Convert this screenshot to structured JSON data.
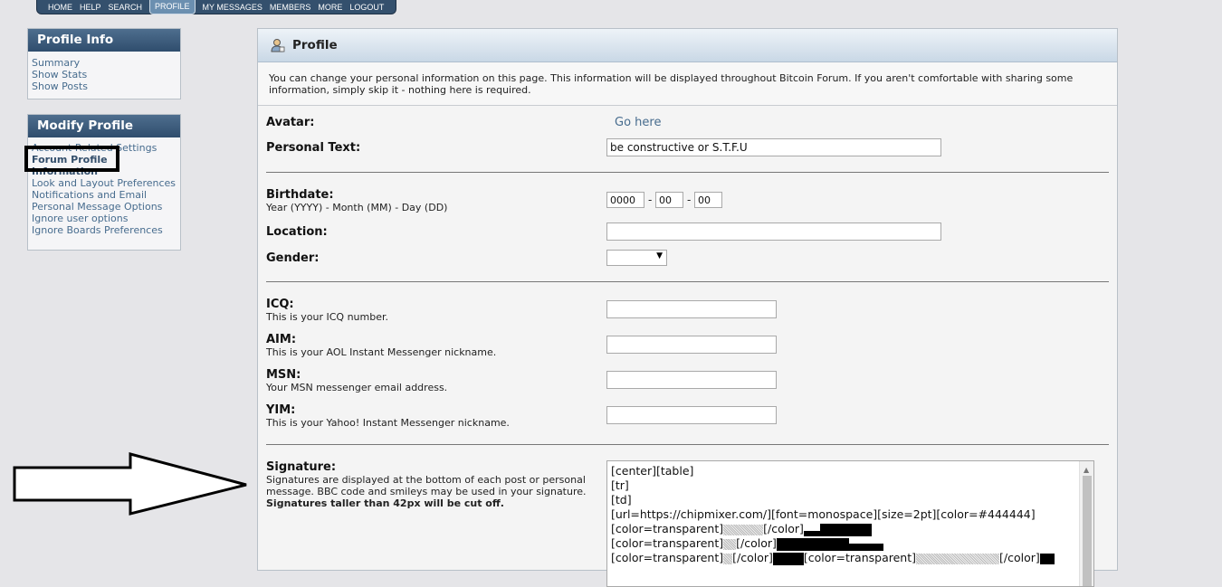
{
  "nav": {
    "items": [
      "HOME",
      "HELP",
      "SEARCH",
      "PROFILE",
      "MY MESSAGES",
      "MEMBERS",
      "MORE",
      "LOGOUT"
    ]
  },
  "sidebar": {
    "profile_info_title": "Profile Info",
    "profile_info_links": [
      "Summary",
      "Show Stats",
      "Show Posts"
    ],
    "modify_title": "Modify Profile",
    "modify_links": [
      "Account Related Settings",
      "Forum Profile Information",
      "Look and Layout Preferences",
      "Notifications and Email",
      "Personal Message Options",
      "Ignore user options",
      "Ignore Boards Preferences"
    ]
  },
  "main": {
    "title": "Profile",
    "intro": "You can change your personal information on this page. This information will be displayed throughout Bitcoin Forum. If you aren't comfortable with sharing some information, simply skip it - nothing here is required.",
    "avatar_label": "Avatar:",
    "avatar_link": "Go here",
    "personal_text_label": "Personal Text:",
    "personal_text_value": "be constructive or S.T.F.U",
    "birthdate_label": "Birthdate:",
    "birthdate_sub": "Year (YYYY) - Month (MM) - Day (DD)",
    "birth_year": "0000",
    "birth_month": "00",
    "birth_day": "00",
    "dash": "-",
    "location_label": "Location:",
    "location_value": "",
    "gender_label": "Gender:",
    "gender_value": "",
    "icq_label": "ICQ:",
    "icq_sub": "This is your ICQ number.",
    "aim_label": "AIM:",
    "aim_sub": "This is your AOL Instant Messenger nickname.",
    "msn_label": "MSN:",
    "msn_sub": "Your MSN messenger email address.",
    "yim_label": "YIM:",
    "yim_sub": "This is your Yahoo! Instant Messenger nickname.",
    "signature_label": "Signature:",
    "signature_sub": "Signatures are displayed at the bottom of each post or personal message. BBC code and smileys may be used in your signature.",
    "signature_warning": "Signatures taller than 42px will be cut off.",
    "signature_lines": [
      "[center][table]",
      "[tr]",
      "[td]",
      "[url=https://chipmixer.com/][font=monospace][size=2pt][color=#444444]",
      "[color=transparent]",
      "[/color]",
      "[color=transparent]",
      "[/color]",
      "[color=transparent]",
      "[/color]",
      "[color=transparent]",
      "[/color]"
    ]
  }
}
